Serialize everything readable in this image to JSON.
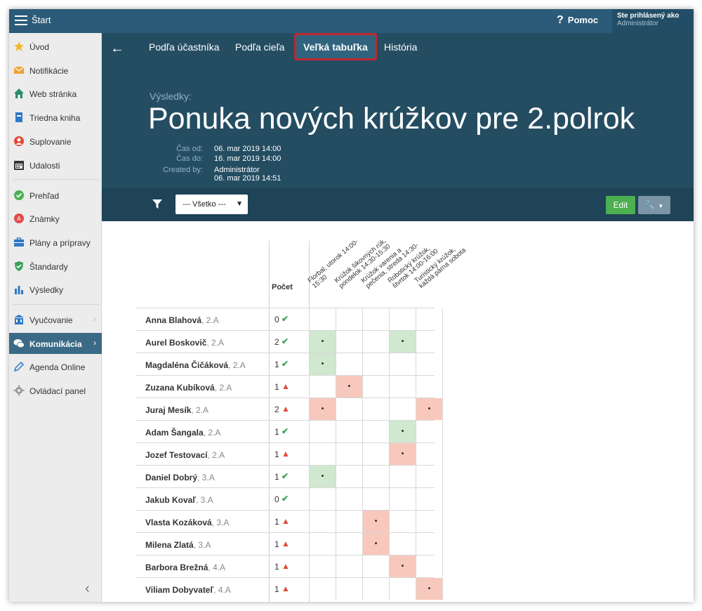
{
  "topbar": {
    "title": "Štart",
    "help_label": "Pomoc",
    "user_line1": "Ste prihlásený ako",
    "user_line2": "Administrátor"
  },
  "sidebar": {
    "items": [
      {
        "label": "Úvod",
        "icon": "star-icon"
      },
      {
        "label": "Notifikácie",
        "icon": "envelope-icon"
      },
      {
        "label": "Web stránka",
        "icon": "home-icon"
      },
      {
        "label": "Triedna kniha",
        "icon": "book-icon"
      },
      {
        "label": "Suplovanie",
        "icon": "user-swap-icon"
      },
      {
        "label": "Udalosti",
        "icon": "calendar-icon"
      },
      {
        "label": "Prehľad",
        "icon": "check-circle-icon"
      },
      {
        "label": "Známky",
        "icon": "grades-icon"
      },
      {
        "label": "Plány a prípravy",
        "icon": "briefcase-icon"
      },
      {
        "label": "Štandardy",
        "icon": "shield-icon"
      },
      {
        "label": "Výsledky",
        "icon": "bar-chart-icon"
      },
      {
        "label": "Vyučovanie",
        "icon": "school-icon"
      },
      {
        "label": "Komunikácia",
        "icon": "chat-icon"
      },
      {
        "label": "Agenda Online",
        "icon": "pen-icon"
      },
      {
        "label": "Ovládací panel",
        "icon": "gear-icon"
      }
    ]
  },
  "tabs": [
    {
      "label": "Podľa účastníka"
    },
    {
      "label": "Podľa cieľa"
    },
    {
      "label": "Veľká tabuľka"
    },
    {
      "label": "História"
    }
  ],
  "results_label": "Výsledky:",
  "page_title": "Ponuka nových krúžkov pre 2.polrok",
  "meta": {
    "time_from_label": "Čas od:",
    "time_from": "06. mar 2019 14:00",
    "time_to_label": "Čas do:",
    "time_to": "16. mar 2019 14:00",
    "created_by_label": "Created by:",
    "created_by": "Administrátor",
    "created_at": "06. mar 2019 14:51"
  },
  "filter": {
    "selected": "--- Všetko ---"
  },
  "buttons": {
    "edit": "Edit"
  },
  "grid": {
    "count_header": "Počet",
    "columns": [
      {
        "line1": "Florbal, utorok 14:00-",
        "line2": "15:30"
      },
      {
        "line1": "Krúžok šikovných rúk,",
        "line2": "pondelok 14:30-15:30"
      },
      {
        "line1": "Krúžok varenia a",
        "line2": "pečenia, streda 14:30-"
      },
      {
        "line1": "Robotický krúžok,",
        "line2": "štvrtok 14:00-16:00"
      },
      {
        "line1": "Turistický krúžok,",
        "line2": "každá párna sobota"
      }
    ],
    "rows": [
      {
        "name": "Anna Blahová",
        "cls": ", 2.A",
        "count": "0",
        "status": "ok",
        "cells": [
          "",
          "",
          "",
          "",
          ""
        ]
      },
      {
        "name": "Aurel Boskovič",
        "cls": ", 2.A",
        "count": "2",
        "status": "ok",
        "cells": [
          "green",
          "",
          "",
          "green",
          ""
        ]
      },
      {
        "name": "Magdaléna Čičáková",
        "cls": ", 2.A",
        "count": "1",
        "status": "ok",
        "cells": [
          "green",
          "",
          "",
          "",
          ""
        ]
      },
      {
        "name": "Zuzana Kubíková",
        "cls": ", 2.A",
        "count": "1",
        "status": "warn",
        "cells": [
          "",
          "red",
          "",
          "",
          ""
        ]
      },
      {
        "name": "Juraj Mesík",
        "cls": ", 2.A",
        "count": "2",
        "status": "warn",
        "cells": [
          "red",
          "",
          "",
          "",
          "red"
        ]
      },
      {
        "name": "Adam Šangala",
        "cls": ", 2.A",
        "count": "1",
        "status": "ok",
        "cells": [
          "",
          "",
          "",
          "green",
          ""
        ]
      },
      {
        "name": "Jozef Testovací",
        "cls": ", 2.A",
        "count": "1",
        "status": "warn",
        "cells": [
          "",
          "",
          "",
          "red",
          ""
        ]
      },
      {
        "name": "Daniel Dobrý",
        "cls": ", 3.A",
        "count": "1",
        "status": "ok",
        "cells": [
          "green",
          "",
          "",
          "",
          ""
        ]
      },
      {
        "name": "Jakub Kovaľ",
        "cls": ", 3.A",
        "count": "0",
        "status": "ok",
        "cells": [
          "",
          "",
          "",
          "",
          ""
        ]
      },
      {
        "name": "Vlasta Kozáková",
        "cls": ", 3.A",
        "count": "1",
        "status": "warn",
        "cells": [
          "",
          "",
          "red",
          "",
          ""
        ]
      },
      {
        "name": "Milena Zlatá",
        "cls": ", 3.A",
        "count": "1",
        "status": "warn",
        "cells": [
          "",
          "",
          "red",
          "",
          ""
        ]
      },
      {
        "name": "Barbora Brežná",
        "cls": ", 4.A",
        "count": "1",
        "status": "warn",
        "cells": [
          "",
          "",
          "",
          "red",
          ""
        ]
      },
      {
        "name": "Viliam Dobyvateľ",
        "cls": ", 4.A",
        "count": "1",
        "status": "warn",
        "cells": [
          "",
          "",
          "",
          "",
          "red"
        ]
      }
    ]
  }
}
